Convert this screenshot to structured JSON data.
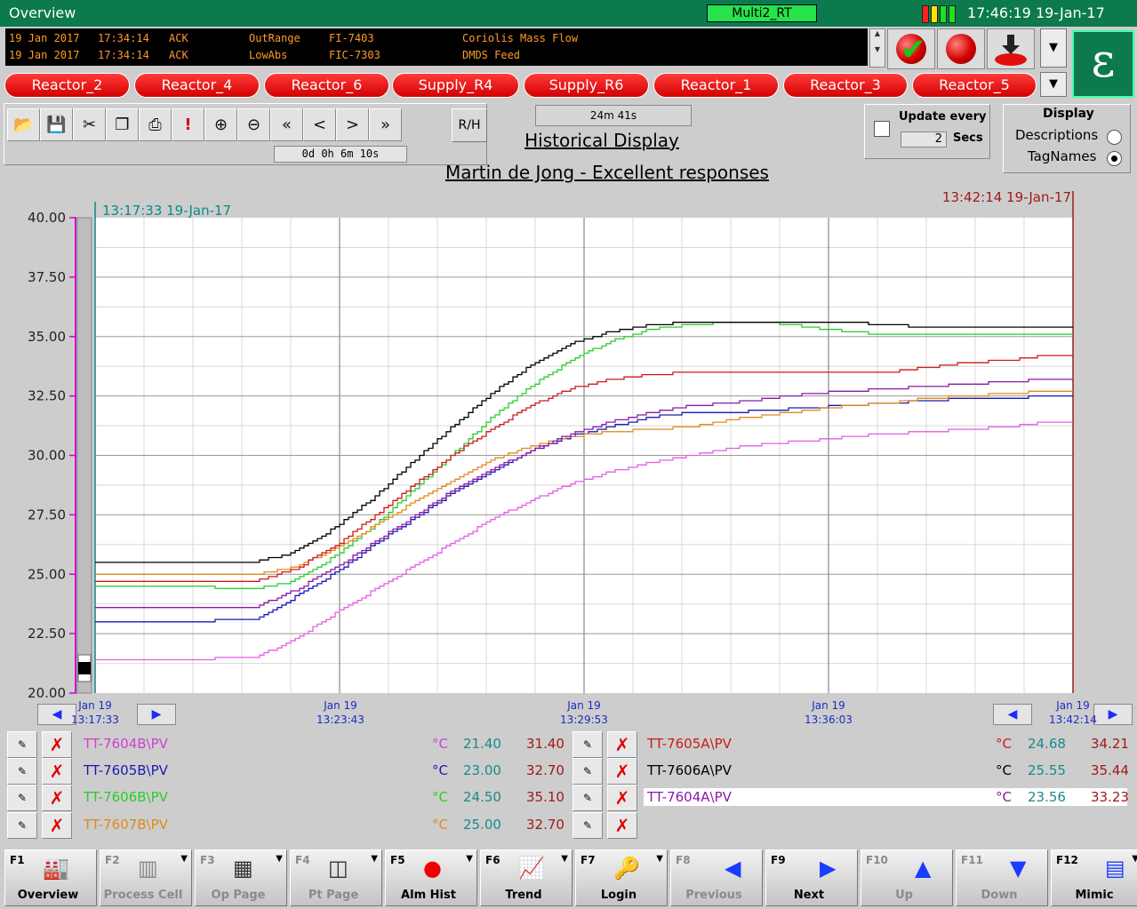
{
  "titlebar": {
    "title": "Overview",
    "server": "Multi2_RT",
    "clock": "17:46:19 19-Jan-17"
  },
  "alarms": [
    {
      "date": "19 Jan 2017",
      "time": "17:34:14",
      "state": "ACK",
      "type": "OutRange",
      "tag": "FI-7403",
      "desc": "Coriolis Mass Flow"
    },
    {
      "date": "19 Jan 2017",
      "time": "17:34:14",
      "state": "ACK",
      "type": "LowAbs",
      "tag": "FIC-7303",
      "desc": "DMDS Feed"
    }
  ],
  "areas": [
    "Reactor_2",
    "Reactor_4",
    "Reactor_6",
    "Supply_R4",
    "Supply_R6",
    "Reactor_1",
    "Reactor_3",
    "Reactor_5"
  ],
  "toolbar": {
    "span": "0d  0h  6m 10s",
    "rh": "R/H",
    "duration": "24m 41s",
    "display_title": "Historical Display",
    "subtitle": "Martin de Jong - Excellent responses"
  },
  "update": {
    "label": "Update every",
    "value": "2",
    "unit": "Secs"
  },
  "display_opts": {
    "label": "Display",
    "descriptions": "Descriptions",
    "tagnames": "TagNames",
    "selected": "TagNames"
  },
  "chart_data": {
    "type": "line",
    "start_label": "13:17:33 19-Jan-17",
    "end_label": "13:42:14 19-Jan-17",
    "ylim": [
      20,
      40
    ],
    "yticks": [
      "40.00",
      "37.50",
      "35.00",
      "32.50",
      "30.00",
      "27.50",
      "25.00",
      "22.50",
      "20.00"
    ],
    "xticks": [
      {
        "date": "Jan 19",
        "time": "13:17:33"
      },
      {
        "date": "Jan 19",
        "time": "13:23:43"
      },
      {
        "date": "Jan 19",
        "time": "13:29:53"
      },
      {
        "date": "Jan 19",
        "time": "13:36:03"
      },
      {
        "date": "Jan 19",
        "time": "13:42:14"
      }
    ],
    "x_minutes": [
      0,
      2,
      4,
      5,
      6,
      7,
      8,
      9,
      10,
      11,
      12,
      13,
      14,
      15,
      16,
      17,
      18,
      19,
      20,
      21,
      22,
      23,
      24,
      24.7
    ],
    "series": [
      {
        "name": "TT-7604B\\PV",
        "color": "#e65ce6",
        "values": [
          21.4,
          21.4,
          21.5,
          22.2,
          23.3,
          24.3,
          25.3,
          26.3,
          27.3,
          28.1,
          28.8,
          29.3,
          29.7,
          30.0,
          30.3,
          30.5,
          30.6,
          30.8,
          30.9,
          31.0,
          31.1,
          31.2,
          31.4,
          31.4
        ]
      },
      {
        "name": "TT-7605B\\PV",
        "color": "#1a1ab4",
        "values": [
          23.0,
          23.0,
          23.1,
          24.0,
          25.0,
          26.2,
          27.3,
          28.4,
          29.3,
          30.2,
          30.8,
          31.2,
          31.6,
          31.8,
          31.8,
          31.9,
          32.0,
          32.1,
          32.2,
          32.3,
          32.4,
          32.4,
          32.5,
          32.5
        ]
      },
      {
        "name": "TT-7606B\\PV",
        "color": "#2acc2a",
        "values": [
          24.5,
          24.5,
          24.4,
          24.7,
          25.7,
          27.0,
          28.5,
          30.0,
          31.6,
          32.9,
          34.0,
          34.8,
          35.3,
          35.5,
          35.6,
          35.6,
          35.4,
          35.2,
          35.1,
          35.1,
          35.1,
          35.1,
          35.1,
          35.1
        ]
      },
      {
        "name": "TT-7607B\\PV",
        "color": "#e08a1a",
        "values": [
          25.0,
          25.0,
          25.0,
          25.3,
          26.0,
          27.0,
          28.0,
          28.9,
          29.8,
          30.4,
          30.8,
          31.0,
          31.1,
          31.2,
          31.5,
          31.7,
          31.9,
          32.1,
          32.2,
          32.4,
          32.5,
          32.6,
          32.7,
          32.7
        ]
      },
      {
        "name": "TT-7605A\\PV",
        "color": "#cc1a1a",
        "values": [
          24.7,
          24.7,
          24.7,
          25.2,
          26.1,
          27.4,
          28.7,
          30.0,
          31.1,
          32.1,
          32.8,
          33.2,
          33.4,
          33.5,
          33.5,
          33.5,
          33.5,
          33.5,
          33.5,
          33.7,
          33.9,
          34.0,
          34.2,
          34.2
        ]
      },
      {
        "name": "TT-7606A\\PV",
        "color": "#000000",
        "values": [
          25.5,
          25.5,
          25.5,
          25.9,
          26.9,
          28.2,
          29.7,
          31.2,
          32.6,
          33.8,
          34.7,
          35.2,
          35.5,
          35.6,
          35.6,
          35.6,
          35.6,
          35.6,
          35.5,
          35.4,
          35.4,
          35.4,
          35.4,
          35.4
        ]
      },
      {
        "name": "TT-7604A\\PV",
        "color": "#8a1aa8",
        "values": [
          23.6,
          23.6,
          23.6,
          24.3,
          25.2,
          26.3,
          27.4,
          28.5,
          29.4,
          30.2,
          30.9,
          31.4,
          31.8,
          32.1,
          32.2,
          32.4,
          32.6,
          32.7,
          32.8,
          32.9,
          33.0,
          33.1,
          33.2,
          33.2
        ]
      }
    ]
  },
  "legend": {
    "left": [
      {
        "tag": "TT-7604B\\PV",
        "unit": "°C",
        "low": "21.40",
        "high": "31.40",
        "color": "#d040d0"
      },
      {
        "tag": "TT-7605B\\PV",
        "unit": "°C",
        "low": "23.00",
        "high": "32.70",
        "color": "#1a1ab4"
      },
      {
        "tag": "TT-7606B\\PV",
        "unit": "°C",
        "low": "24.50",
        "high": "35.10",
        "color": "#2acc2a"
      },
      {
        "tag": "TT-7607B\\PV",
        "unit": "°C",
        "low": "25.00",
        "high": "32.70",
        "color": "#e08a1a"
      }
    ],
    "right": [
      {
        "tag": "TT-7605A\\PV",
        "unit": "°C",
        "low": "24.68",
        "high": "34.21",
        "color": "#cc1a1a"
      },
      {
        "tag": "TT-7606A\\PV",
        "unit": "°C",
        "low": "25.55",
        "high": "35.44",
        "color": "#000000"
      },
      {
        "tag": "TT-7604A\\PV",
        "unit": "°C",
        "low": "23.56",
        "high": "33.23",
        "color": "#8a1aa8"
      }
    ]
  },
  "fkeys": [
    {
      "fn": "F1",
      "label": "Overview",
      "enabled": true
    },
    {
      "fn": "F2",
      "label": "Process Cell",
      "enabled": false
    },
    {
      "fn": "F3",
      "label": "Op Page",
      "enabled": false
    },
    {
      "fn": "F4",
      "label": "Pt Page",
      "enabled": false
    },
    {
      "fn": "F5",
      "label": "Alm Hist",
      "enabled": true
    },
    {
      "fn": "F6",
      "label": "Trend",
      "enabled": true
    },
    {
      "fn": "F7",
      "label": "Login",
      "enabled": true
    },
    {
      "fn": "F8",
      "label": "Previous",
      "enabled": false
    },
    {
      "fn": "F9",
      "label": "Next",
      "enabled": true
    },
    {
      "fn": "F10",
      "label": "Up",
      "enabled": false
    },
    {
      "fn": "F11",
      "label": "Down",
      "enabled": false
    },
    {
      "fn": "F12",
      "label": "Mimic",
      "enabled": true
    }
  ],
  "colors": {
    "brand": "#0c7a4c",
    "alarm_text": "#ff9a26",
    "area_tab": "#e00000",
    "cursor_left": "#0a8a8a",
    "cursor_right": "#a01a1a"
  }
}
